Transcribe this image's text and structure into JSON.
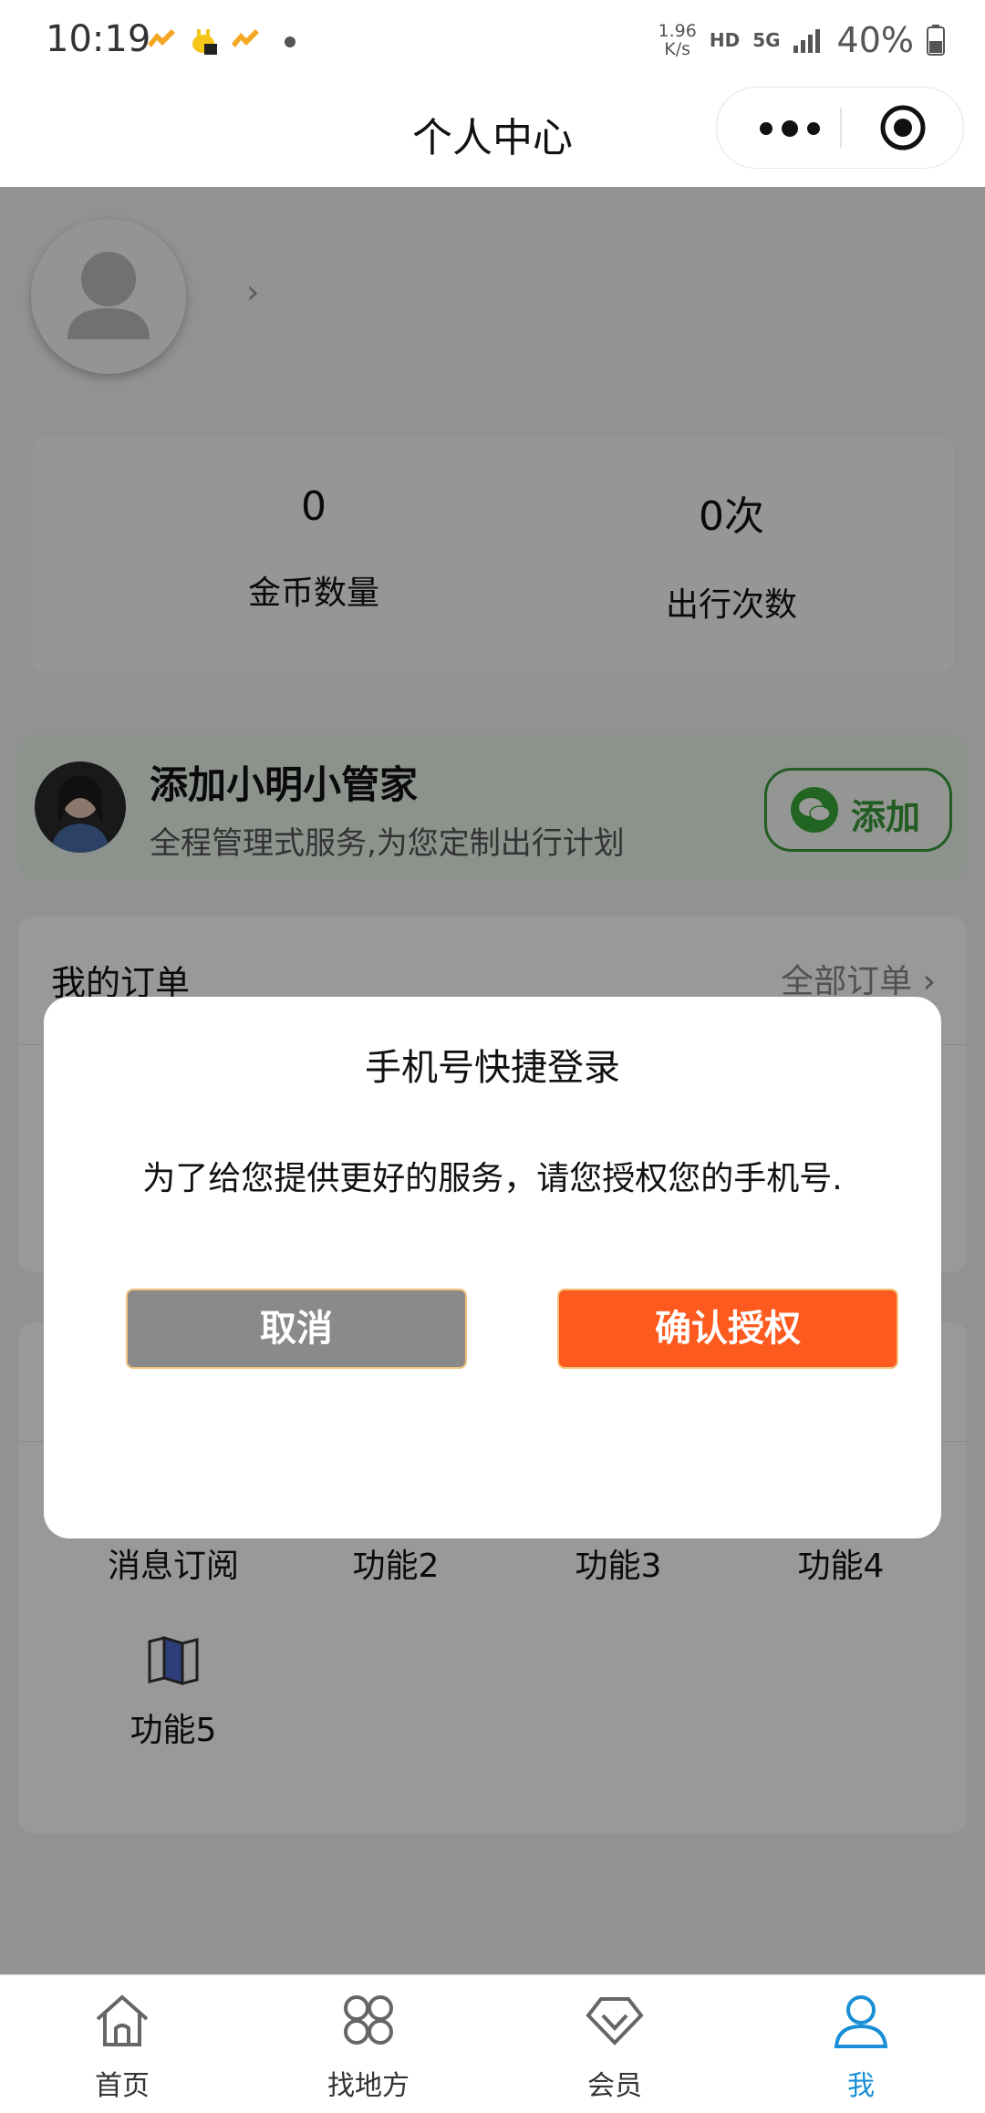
{
  "status_bar": {
    "time": "10:19",
    "net_speed_value": "1.96",
    "net_speed_unit": "K/s",
    "hd": "HD",
    "network": "5G",
    "battery": "40%"
  },
  "nav": {
    "title": "个人中心"
  },
  "profile": {
    "coins_value": "0",
    "coins_label": "金币数量",
    "trips_value": "0次",
    "trips_label": "出行次数"
  },
  "assistant": {
    "title": "添加小明小管家",
    "subtitle": "全程管理式服务,为您定制出行计划",
    "button": "添加"
  },
  "orders": {
    "title": "我的订单",
    "all": "全部订单"
  },
  "functions": [
    {
      "label": "消息订阅"
    },
    {
      "label": "功能2"
    },
    {
      "label": "功能3"
    },
    {
      "label": "功能4"
    },
    {
      "label": "功能5"
    }
  ],
  "dialog": {
    "title": "手机号快捷登录",
    "message": "为了给您提供更好的服务，请您授权您的手机号.",
    "cancel": "取消",
    "confirm": "确认授权"
  },
  "tabbar": [
    {
      "label": "首页",
      "active": false
    },
    {
      "label": "找地方",
      "active": false
    },
    {
      "label": "会员",
      "active": false
    },
    {
      "label": "我",
      "active": true
    }
  ],
  "colors": {
    "accent": "#fc5a1e",
    "tab_active": "#1a8fd6",
    "wechat_green": "#3a9a3a"
  }
}
